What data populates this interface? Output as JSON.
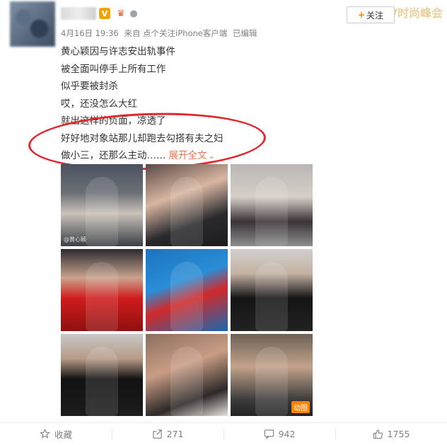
{
  "post": {
    "date": "4月16日 19:36",
    "source": "来自 点个关注iPhone客户端",
    "edited": "已编辑",
    "lines": [
      "黄心颖因与许志安出轨事件",
      "被全面叫停手上所有工作",
      "似乎要被封杀",
      "哎，还没怎么大红",
      "就出这样的负面，凉透了",
      "好好地对象站那儿却跑去勾搭有夫之妇",
      "做小三，还那么主动……"
    ],
    "expand_label": "展开全文",
    "expand_icon": "chevron-down-icon"
  },
  "header": {
    "follow_plus": "+",
    "follow_label": "关注",
    "badge_v": "V",
    "watermark": "V时尚峰会"
  },
  "images": {
    "caption_1": "@黄心颖",
    "gif_tag": "动图"
  },
  "actions": {
    "favorite_label": "收藏",
    "repost_count": "271",
    "comment_count": "942",
    "like_count": "1755"
  },
  "colors": {
    "accent": "#eb7350",
    "follow_plus": "#ff8200",
    "annotation_red": "#e0282e"
  }
}
